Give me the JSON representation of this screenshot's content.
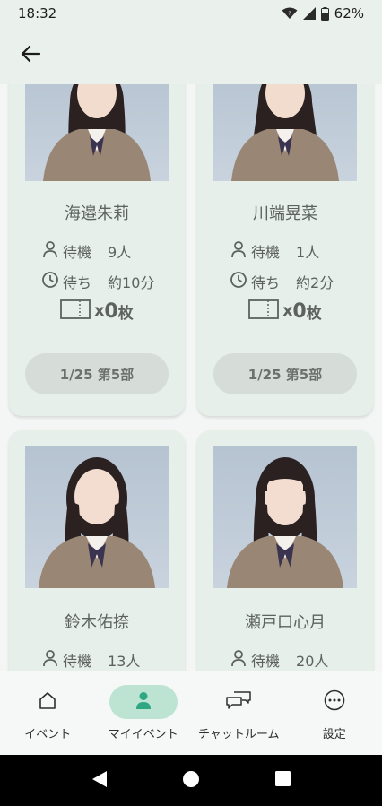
{
  "status_bar": {
    "time": "18:32",
    "battery": "62%",
    "icons": [
      "wifi-icon",
      "signal-icon",
      "battery-icon"
    ]
  },
  "app_bar": {
    "back_icon": "arrow-left-icon"
  },
  "cards": [
    {
      "name": "海邉朱莉",
      "wait_label": "待機",
      "wait_value": "9人",
      "time_label": "待ち",
      "time_value": "約10分",
      "ticket_x": "x",
      "ticket_count": "0",
      "ticket_unit": "枚",
      "slot": "1/25 第5部"
    },
    {
      "name": "川端晃菜",
      "wait_label": "待機",
      "wait_value": "1人",
      "time_label": "待ち",
      "time_value": "約2分",
      "ticket_x": "x",
      "ticket_count": "0",
      "ticket_unit": "枚",
      "slot": "1/25 第5部"
    },
    {
      "name": "鈴木佑捺",
      "wait_label": "待機",
      "wait_value": "13人"
    },
    {
      "name": "瀬戸口心月",
      "wait_label": "待機",
      "wait_value": "20人"
    }
  ],
  "bottom_nav": {
    "items": [
      {
        "label": "イベント",
        "icon": "home-icon",
        "active": false
      },
      {
        "label": "マイイベント",
        "icon": "person-icon",
        "active": true
      },
      {
        "label": "チャットルーム",
        "icon": "chat-icon",
        "active": false
      },
      {
        "label": "設定",
        "icon": "more-icon",
        "active": false
      }
    ]
  },
  "colors": {
    "accent": "#2fa782",
    "active_pill": "#bde4d3",
    "card_bg": "#e7efea",
    "slot_button": "#d6dcd8"
  }
}
